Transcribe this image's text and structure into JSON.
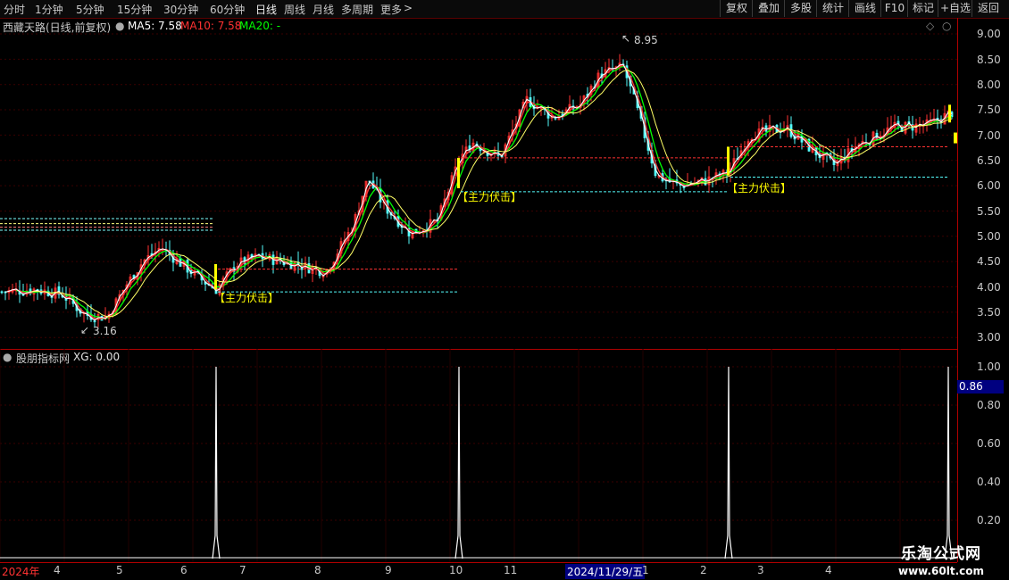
{
  "toolbar": {
    "timeframes": [
      "分时",
      "1分钟",
      "5分钟",
      "15分钟",
      "30分钟",
      "60分钟",
      "日线",
      "周线",
      "月线",
      "多周期",
      "更多"
    ],
    "more_arrow": ">",
    "buttons": [
      "复权",
      "叠加",
      "多股",
      "统计",
      "画线",
      "F10",
      "标记",
      "+自选",
      "返回"
    ]
  },
  "header": {
    "title": "西藏天路(日线,前复权)",
    "ma5": "MA5: 7.58",
    "ma10": "MA10: 7.58",
    "ma20": "MA20: -"
  },
  "indicator": {
    "title": "股朋指标网",
    "xg": "XG: 0.00",
    "cursor_value": "0.86"
  },
  "price_axis": [
    "9.00",
    "8.50",
    "8.00",
    "7.50",
    "7.00",
    "6.50",
    "6.00",
    "5.50",
    "5.00",
    "4.50",
    "4.00",
    "3.50",
    "3.00"
  ],
  "ind_axis": [
    "1.00",
    "0.80",
    "0.60",
    "0.40",
    "0.20"
  ],
  "annotations": {
    "high": "8.95",
    "low": "3.16",
    "signal": "【主力伏击】"
  },
  "date_axis": [
    "2024年",
    "4",
    "5",
    "6",
    "7",
    "8",
    "9",
    "10",
    "11",
    "2024/11/29/五",
    "1",
    "2",
    "3",
    "4"
  ],
  "watermark": {
    "name": "乐淘公式网",
    "url": "www.60lt.com"
  },
  "colors": {
    "up": "#ff3232",
    "down": "#54fcfc",
    "ma5": "#ffffff",
    "ma10": "#ff3232",
    "ma20": "#00ff00",
    "signal": "#ffff00"
  }
}
